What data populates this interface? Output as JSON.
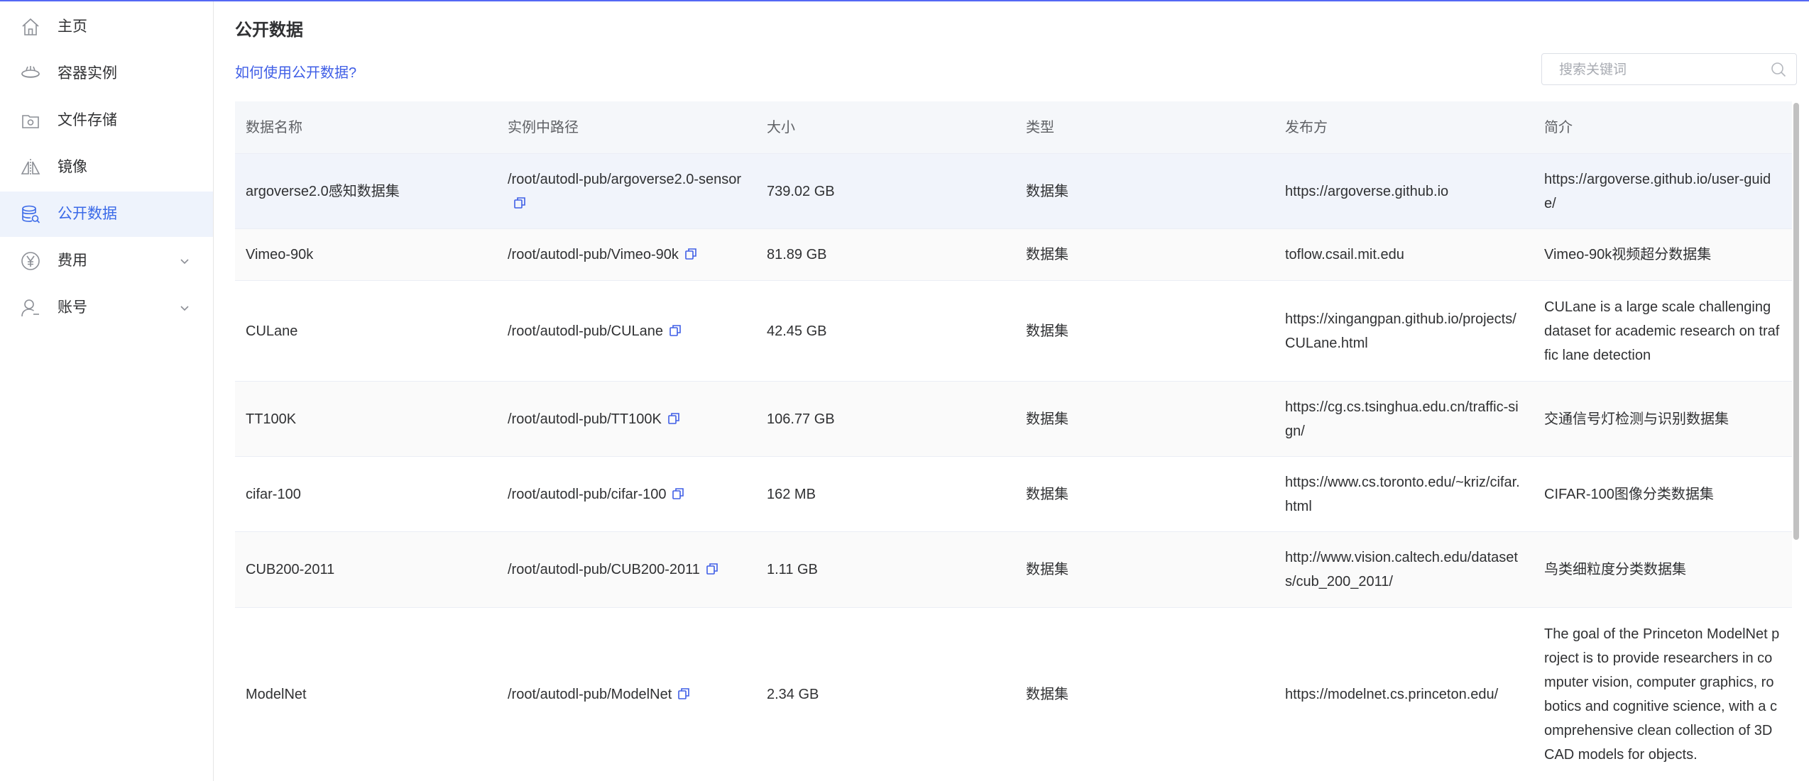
{
  "sidebar": {
    "items": [
      {
        "label": "主页"
      },
      {
        "label": "容器实例"
      },
      {
        "label": "文件存储"
      },
      {
        "label": "镜像"
      },
      {
        "label": "公开数据"
      },
      {
        "label": "费用"
      },
      {
        "label": "账号"
      }
    ],
    "active_color": "#3b6ae8"
  },
  "main": {
    "title": "公开数据",
    "help_link": "如何使用公开数据?",
    "search": {
      "placeholder": "搜索关键词",
      "value": ""
    }
  },
  "table": {
    "headers": [
      "数据名称",
      "实例中路径",
      "大小",
      "类型",
      "发布方",
      "简介"
    ],
    "rows": [
      {
        "name": "argoverse2.0感知数据集",
        "path": "/root/autodl-pub/argoverse2.0-sensor",
        "size": "739.02 GB",
        "type": "数据集",
        "publisher": "https://argoverse.github.io",
        "desc": "https://argoverse.github.io/user-guide/"
      },
      {
        "name": "Vimeo-90k",
        "path": "/root/autodl-pub/Vimeo-90k",
        "size": "81.89 GB",
        "type": "数据集",
        "publisher": "toflow.csail.mit.edu",
        "desc": "Vimeo-90k视频超分数据集"
      },
      {
        "name": "CULane",
        "path": "/root/autodl-pub/CULane",
        "size": "42.45 GB",
        "type": "数据集",
        "publisher": "https://xingangpan.github.io/projects/CULane.html",
        "desc": "CULane is a large scale challenging dataset for academic research on traffic lane detection"
      },
      {
        "name": "TT100K",
        "path": "/root/autodl-pub/TT100K",
        "size": "106.77 GB",
        "type": "数据集",
        "publisher": "https://cg.cs.tsinghua.edu.cn/traffic-sign/",
        "desc": "交通信号灯检测与识别数据集"
      },
      {
        "name": "cifar-100",
        "path": "/root/autodl-pub/cifar-100",
        "size": "162 MB",
        "type": "数据集",
        "publisher": "https://www.cs.toronto.edu/~kriz/cifar.html",
        "desc": "CIFAR-100图像分类数据集"
      },
      {
        "name": "CUB200-2011",
        "path": "/root/autodl-pub/CUB200-2011",
        "size": "1.11 GB",
        "type": "数据集",
        "publisher": "http://www.vision.caltech.edu/datasets/cub_200_2011/",
        "desc": "鸟类细粒度分类数据集"
      },
      {
        "name": "ModelNet",
        "path": "/root/autodl-pub/ModelNet",
        "size": "2.34 GB",
        "type": "数据集",
        "publisher": "https://modelnet.cs.princeton.edu/",
        "desc": "The goal of the Princeton ModelNet project is to provide researchers in computer vision, computer graphics, robotics and cognitive science, with a comprehensive clean collection of 3D CAD models for objects."
      }
    ]
  }
}
